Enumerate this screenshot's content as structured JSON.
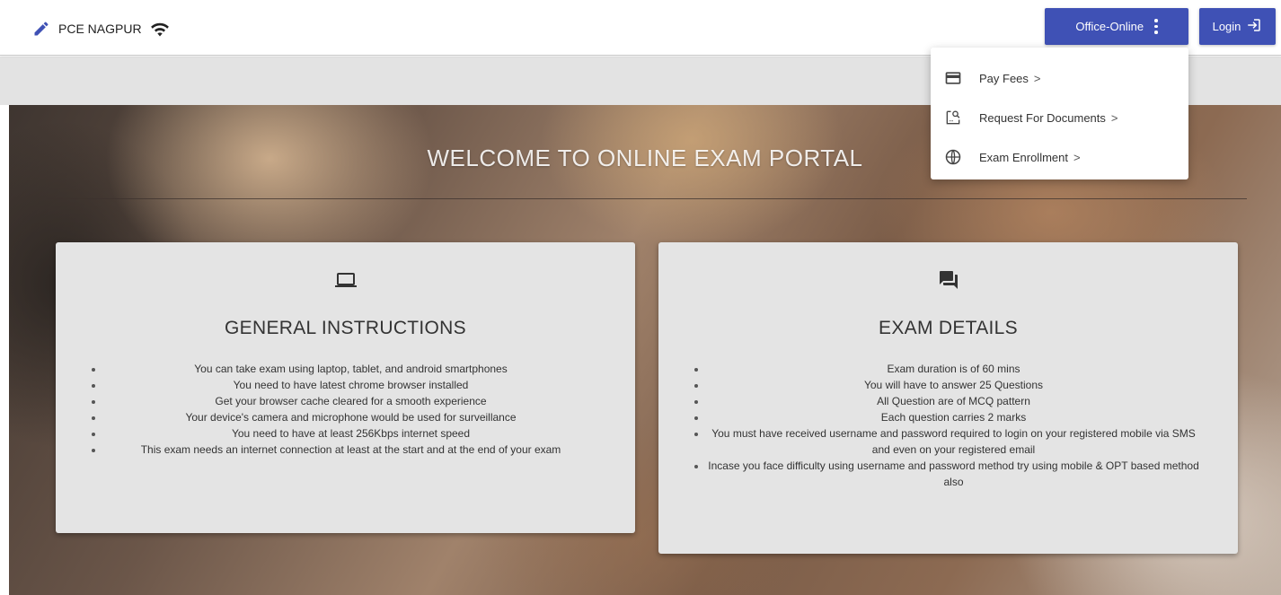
{
  "header": {
    "brand_label": "PCE NAGPUR",
    "office_button_label": "Office-Online",
    "login_button_label": "Login"
  },
  "office_menu": {
    "items": [
      {
        "label": "Pay Fees",
        "chevron": ">",
        "icon": "credit-card-icon"
      },
      {
        "label": "Request For Documents",
        "chevron": ">",
        "icon": "document-search-icon"
      },
      {
        "label": "Exam Enrollment",
        "chevron": ">",
        "icon": "globe-icon"
      }
    ]
  },
  "hero": {
    "title": "WELCOME TO ONLINE EXAM PORTAL"
  },
  "general_instructions": {
    "icon": "laptop-icon",
    "title": "GENERAL INSTRUCTIONS",
    "items": [
      "You can take exam using laptop, tablet, and android smartphones",
      "You need to have latest chrome browser installed",
      "Get your browser cache cleared for a smooth experience",
      "Your device's camera and microphone would be used for surveillance",
      "You need to have at least 256Kbps internet speed",
      "This exam needs an internet connection at least at the start and at the end of your exam"
    ]
  },
  "exam_details": {
    "icon": "chat-icon",
    "title": "EXAM DETAILS",
    "items": [
      "Exam duration is of 60 mins",
      "You will have to answer 25 Questions",
      "All Question are of MCQ pattern",
      "Each question carries 2 marks",
      "You must have received username and password required to login on your registered mobile via SMS and even on your registered email",
      "Incase you face difficulty using username and password method try using mobile & OPT based method also"
    ]
  },
  "colors": {
    "primary": "#3f51b5",
    "card_bg": "#e4e4e4",
    "strip_bg": "#e3e3e3"
  }
}
